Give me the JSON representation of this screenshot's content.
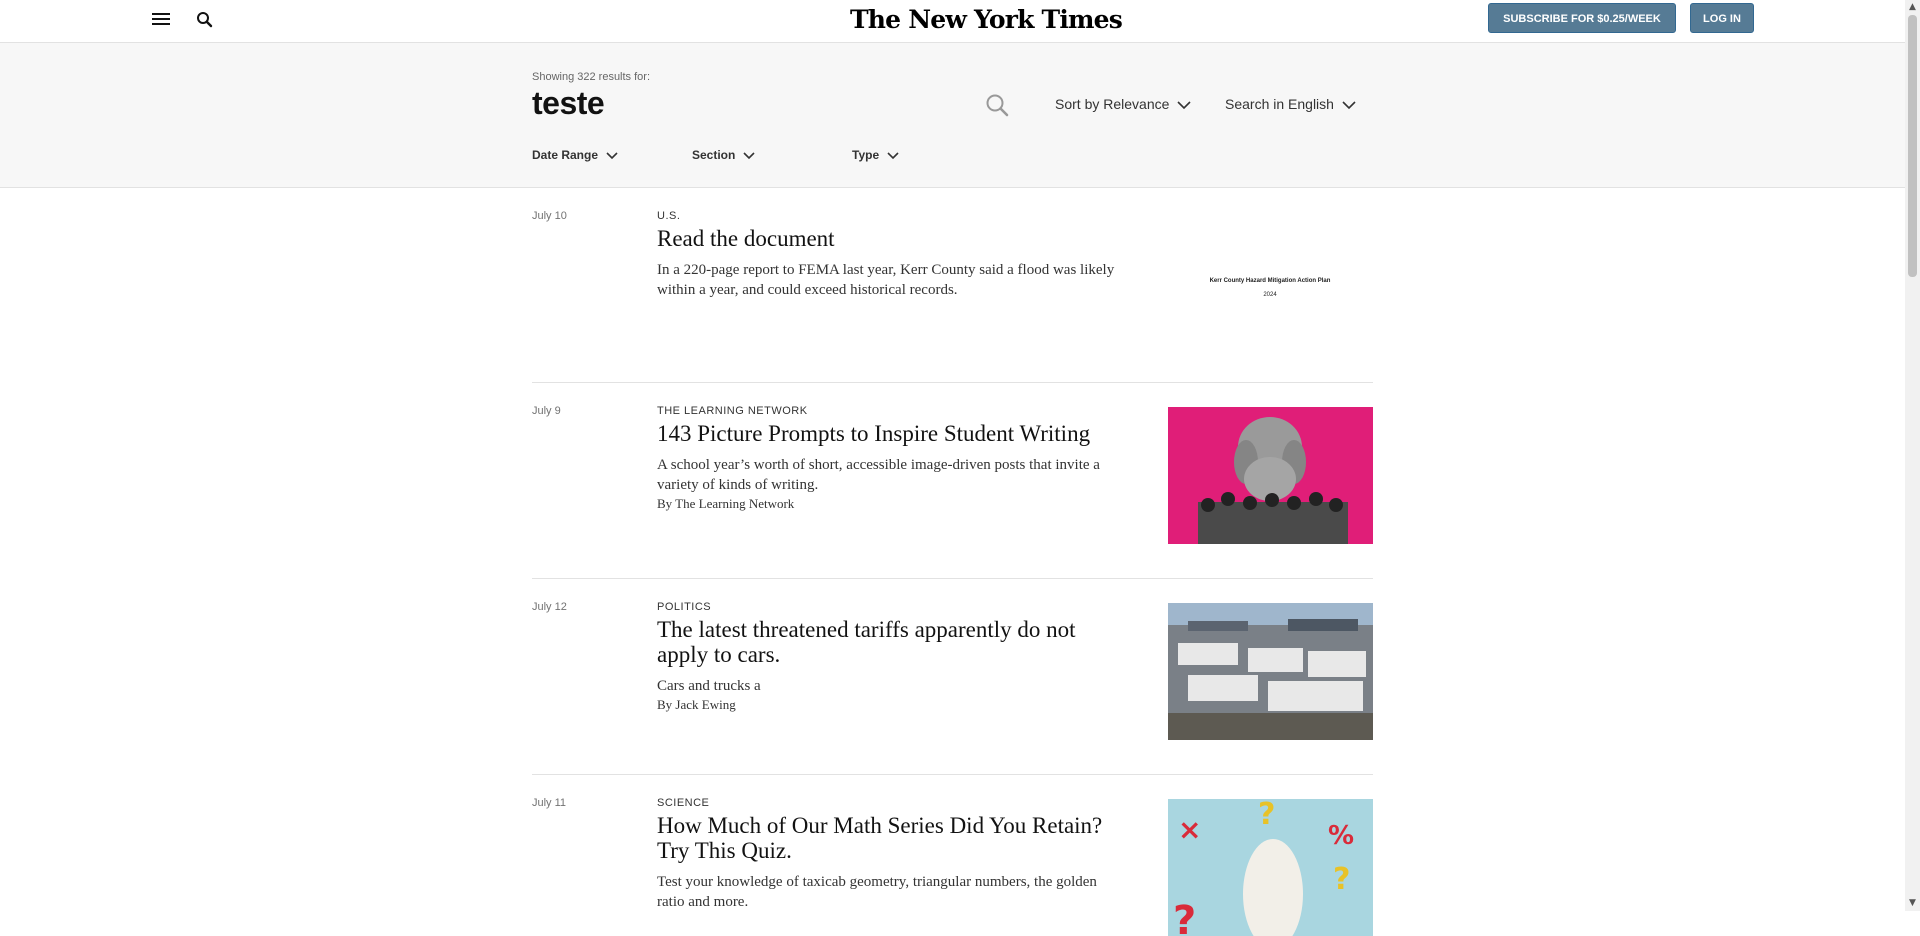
{
  "header": {
    "logo": "The New York Times",
    "subscribe_label": "SUBSCRIBE FOR $0.25/WEEK",
    "login_label": "LOG IN"
  },
  "search": {
    "showing_text": "Showing 322 results for:",
    "query": "teste",
    "sort_label": "Sort by Relevance",
    "language_label": "Search in English",
    "filters": {
      "date_range": "Date Range",
      "section": "Section",
      "type": "Type"
    }
  },
  "results": [
    {
      "date": "July 10",
      "kicker": "U.S.",
      "title": "Read the document",
      "summary": "In a 220-page report to FEMA last year, Kerr County said a flood was likely within a year, and could exceed historical records.",
      "byline": "",
      "thumb_line1": "Kerr County Hazard Mitigation Action Plan",
      "thumb_line2": "2024"
    },
    {
      "date": "July 9",
      "kicker": "THE LEARNING NETWORK",
      "title": "143 Picture Prompts to Inspire Student Writing",
      "summary": "A school year’s worth of short, accessible image-driven posts that invite a variety of kinds of writing.",
      "byline": "By The Learning Network"
    },
    {
      "date": "July 12",
      "kicker": "POLITICS",
      "title": "The latest threatened tariffs apparently do not apply to cars.",
      "summary": "Cars and trucks a",
      "byline": "By Jack Ewing"
    },
    {
      "date": "July 11",
      "kicker": "SCIENCE",
      "title": "How Much of Our Math Series Did You Retain? Try This Quiz.",
      "summary": "Test your knowledge of taxicab geometry, triangular numbers, the golden ratio and more.",
      "byline": ""
    }
  ],
  "colors": {
    "button_bg": "#567b95",
    "panel_bg": "#f7f7f7",
    "divider": "#e2e2e2"
  }
}
